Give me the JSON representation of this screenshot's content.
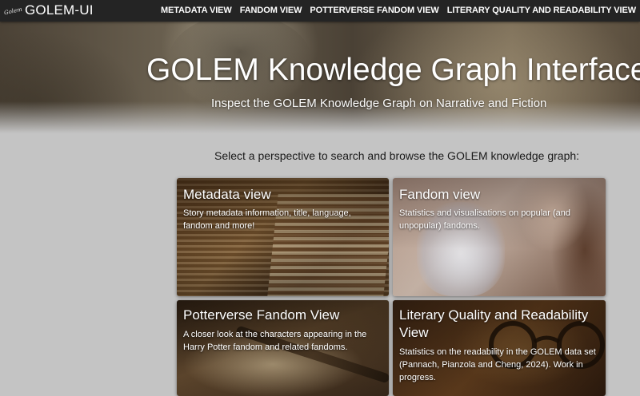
{
  "appbar": {
    "logo_text": "Golem",
    "brand": "GOLEM-UI",
    "nav": [
      {
        "label": "METADATA VIEW"
      },
      {
        "label": "FANDOM VIEW"
      },
      {
        "label": "POTTERVERSE FANDOM VIEW"
      },
      {
        "label": "LITERARY QUALITY AND READABILITY VIEW"
      }
    ]
  },
  "hero": {
    "title": "GOLEM Knowledge Graph Interface",
    "subtitle": "Inspect the GOLEM Knowledge Graph on Narrative and Fiction"
  },
  "prompt": "Select a perspective to search and browse the GOLEM knowledge graph:",
  "cards": [
    {
      "title": "Metadata view",
      "description": "Story metadata information, title, language, fandom and more!"
    },
    {
      "title": "Fandom view",
      "description": "Statistics and visualisations on popular (and unpopular) fandoms."
    },
    {
      "title": "Potterverse Fandom View",
      "description": "A closer look at the characters appearing in the Harry Potter fandom and related fandoms."
    },
    {
      "title": "Literary Quality and Readability View",
      "description": "Statistics on the readability in the GOLEM data set (Pannach, Pianzola and Cheng, 2024). Work in progress."
    }
  ],
  "colors": {
    "appbar_bg": "#242424",
    "page_bg": "#c4c4c4",
    "text_on_dark": "#ffffff"
  }
}
